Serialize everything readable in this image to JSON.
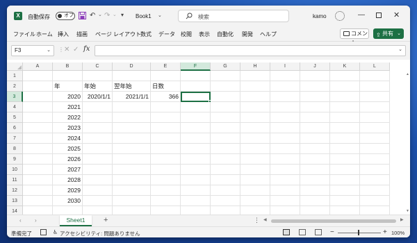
{
  "app": {
    "autosave_label": "自動保存",
    "autosave_state": "オフ",
    "document_title": "Book1",
    "search_placeholder": "検索",
    "user_name": "kamo"
  },
  "menu": {
    "items": [
      "ファイル",
      "ホーム",
      "挿入",
      "描画",
      "ページ レイアウト",
      "数式",
      "データ",
      "校閲",
      "表示",
      "自動化",
      "開発",
      "ヘルプ"
    ],
    "comment_label": "コメント",
    "share_label": "共有"
  },
  "formula_bar": {
    "name_box": "F3",
    "fx_label": "fx",
    "formula": ""
  },
  "sheet": {
    "columns": [
      "A",
      "B",
      "C",
      "D",
      "E",
      "F",
      "G",
      "H",
      "I",
      "J",
      "K",
      "L"
    ],
    "active_column": "F",
    "rows": [
      "1",
      "2",
      "3",
      "4",
      "5",
      "6",
      "7",
      "8",
      "9",
      "10",
      "11",
      "12",
      "13",
      "14"
    ],
    "active_row": "3",
    "headers": {
      "B2": "年",
      "C2": "年始",
      "D2": "翌年始",
      "E2": "日数"
    },
    "values": {
      "C3": "2020/1/1",
      "D3": "2021/1/1",
      "E3": "366"
    },
    "years": [
      "2020",
      "2021",
      "2022",
      "2023",
      "2024",
      "2025",
      "2026",
      "2027",
      "2028",
      "2029",
      "2030"
    ]
  },
  "tabs": {
    "sheet_name": "Sheet1",
    "add_label": "+"
  },
  "status": {
    "ready": "準備完了",
    "accessibility": "アクセシビリティ: 問題ありません",
    "zoom": "100%"
  },
  "colors": {
    "accent": "#1d7044",
    "header_active": "#d3e9dc"
  }
}
